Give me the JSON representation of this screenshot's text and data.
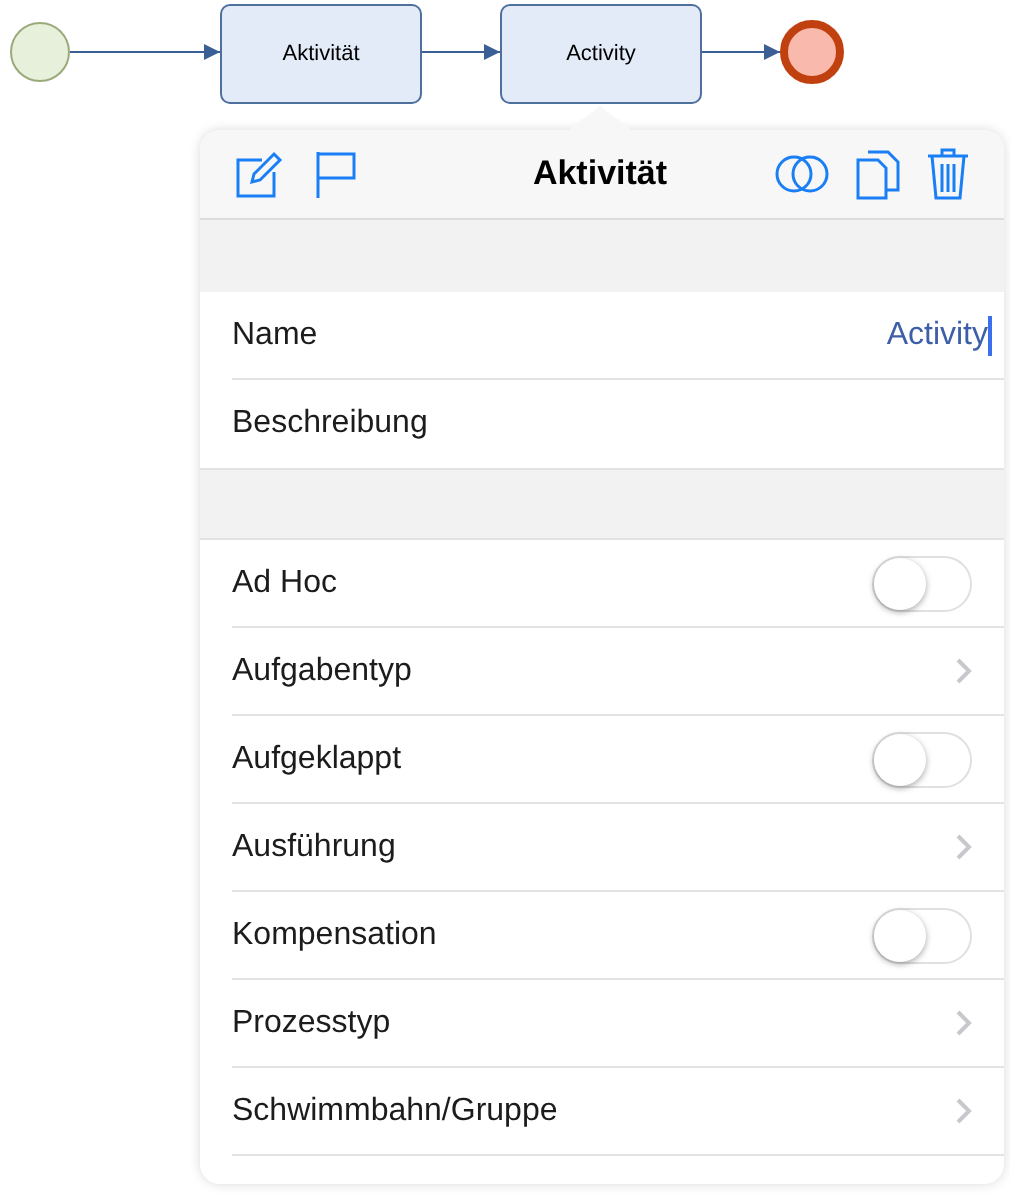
{
  "diagram": {
    "nodes": [
      {
        "kind": "start"
      },
      {
        "kind": "task",
        "label": "Aktivität"
      },
      {
        "kind": "task",
        "label": "Activity"
      },
      {
        "kind": "end"
      }
    ]
  },
  "panel": {
    "title": "Aktivität",
    "fields": [
      {
        "label": "Name",
        "value": "Activity"
      },
      {
        "label": "Beschreibung"
      }
    ],
    "properties": [
      {
        "kind": "toggle",
        "label": "Ad Hoc",
        "on": false
      },
      {
        "kind": "disclosure",
        "label": "Aufgabentyp"
      },
      {
        "kind": "toggle",
        "label": "Aufgeklappt",
        "on": false
      },
      {
        "kind": "disclosure",
        "label": "Ausführung"
      },
      {
        "kind": "toggle",
        "label": "Kompensation",
        "on": false
      },
      {
        "kind": "disclosure",
        "label": "Prozesstyp"
      },
      {
        "kind": "disclosure",
        "label": "Schwimmbahn/Gruppe"
      }
    ]
  }
}
